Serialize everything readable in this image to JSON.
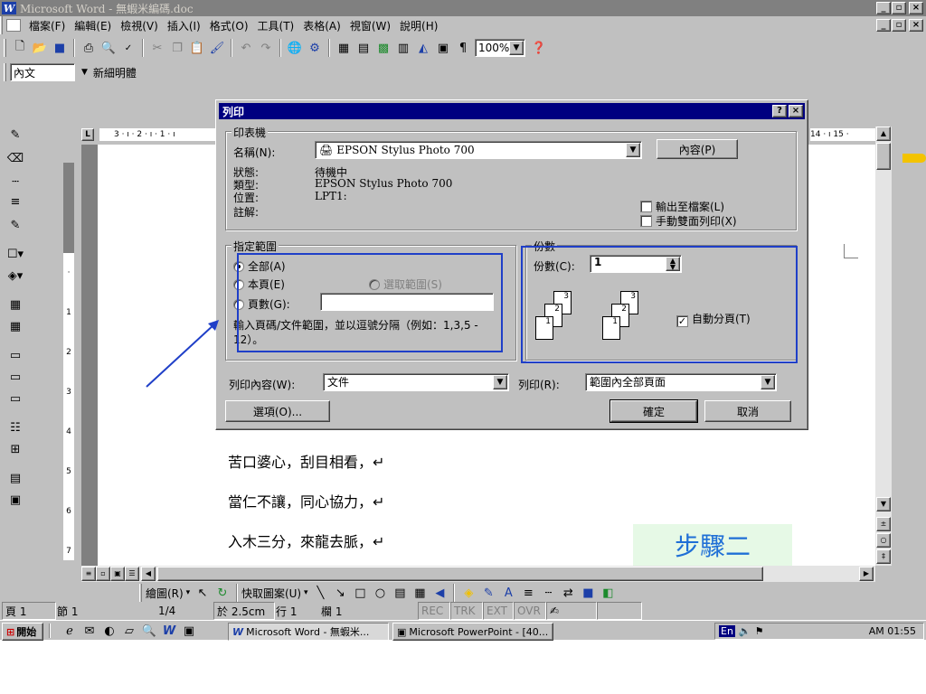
{
  "window": {
    "title": "Microsoft Word - 無蝦米編碼.doc"
  },
  "menu": {
    "items": [
      "檔案(F)",
      "編輯(E)",
      "檢視(V)",
      "插入(I)",
      "格式(O)",
      "工具(T)",
      "表格(A)",
      "視窗(W)",
      "說明(H)"
    ]
  },
  "toolbar": {
    "zoom": "100%"
  },
  "format_bar": {
    "style": "內文",
    "font": "新細明體"
  },
  "ruler": {
    "left_marks": "3 · ı · 2 · ı · 1 · ı",
    "right_marks": "14 · ı 15 ·"
  },
  "dialog": {
    "title": "列印",
    "help_btn": "?",
    "close_btn": "×",
    "printer": {
      "legend": "印表機",
      "name_label": "名稱(N):",
      "name_value": "EPSON Stylus Photo 700",
      "properties_btn": "內容(P)",
      "status_label": "狀態:",
      "status_value": "待機中",
      "type_label": "類型:",
      "type_value": "EPSON Stylus Photo 700",
      "where_label": "位置:",
      "where_value": "LPT1:",
      "comment_label": "註解:",
      "print_to_file": "輸出至檔案(L)",
      "manual_duplex": "手動雙面列印(X)"
    },
    "range": {
      "legend": "指定範圍",
      "all": "全部(A)",
      "current": "本頁(E)",
      "selection": "選取範圍(S)",
      "pages": "頁數(G):",
      "hint": "輸入頁碼/文件範圍，並以逗號分隔（例如：1,3,5 - 12）。"
    },
    "copies": {
      "legend": "份數",
      "count_label": "份數(C):",
      "count_value": "1",
      "collate": "自動分頁(T)",
      "page_numbers": [
        "3",
        "2",
        "1",
        "3",
        "2",
        "1"
      ]
    },
    "print_what_label": "列印內容(W):",
    "print_what_value": "文件",
    "print_label": "列印(R):",
    "print_value": "範圍內全部頁面",
    "options_btn": "選項(O)...",
    "ok_btn": "確定",
    "cancel_btn": "取消"
  },
  "document": {
    "lines": [
      "苦口婆心，刮目相看，↵",
      "當仁不讓，同心協力，↵",
      "入木三分，來龍去脈，↵"
    ]
  },
  "callout": {
    "text": "步驟二",
    "bg": "#e6f9e6",
    "color": "#1f6fd6"
  },
  "annotation": {
    "box_color": "#1f3fc8",
    "arrow_color": "#1f3fc8"
  },
  "drawing_bar": {
    "draw": "繪圖(R)",
    "autoshapes": "快取圖案(U)"
  },
  "status": {
    "page": "頁 1",
    "section": "節 1",
    "pages": "1/4",
    "at": "於 2.5cm",
    "line": "行 1",
    "col": "欄 1",
    "modes": [
      "REC",
      "TRK",
      "EXT",
      "OVR"
    ]
  },
  "taskbar": {
    "start": "開始",
    "tasks": [
      "Microsoft Word - 無蝦米...",
      "Microsoft PowerPoint - [40..."
    ],
    "lang": "En",
    "clock": "AM 01:55"
  }
}
